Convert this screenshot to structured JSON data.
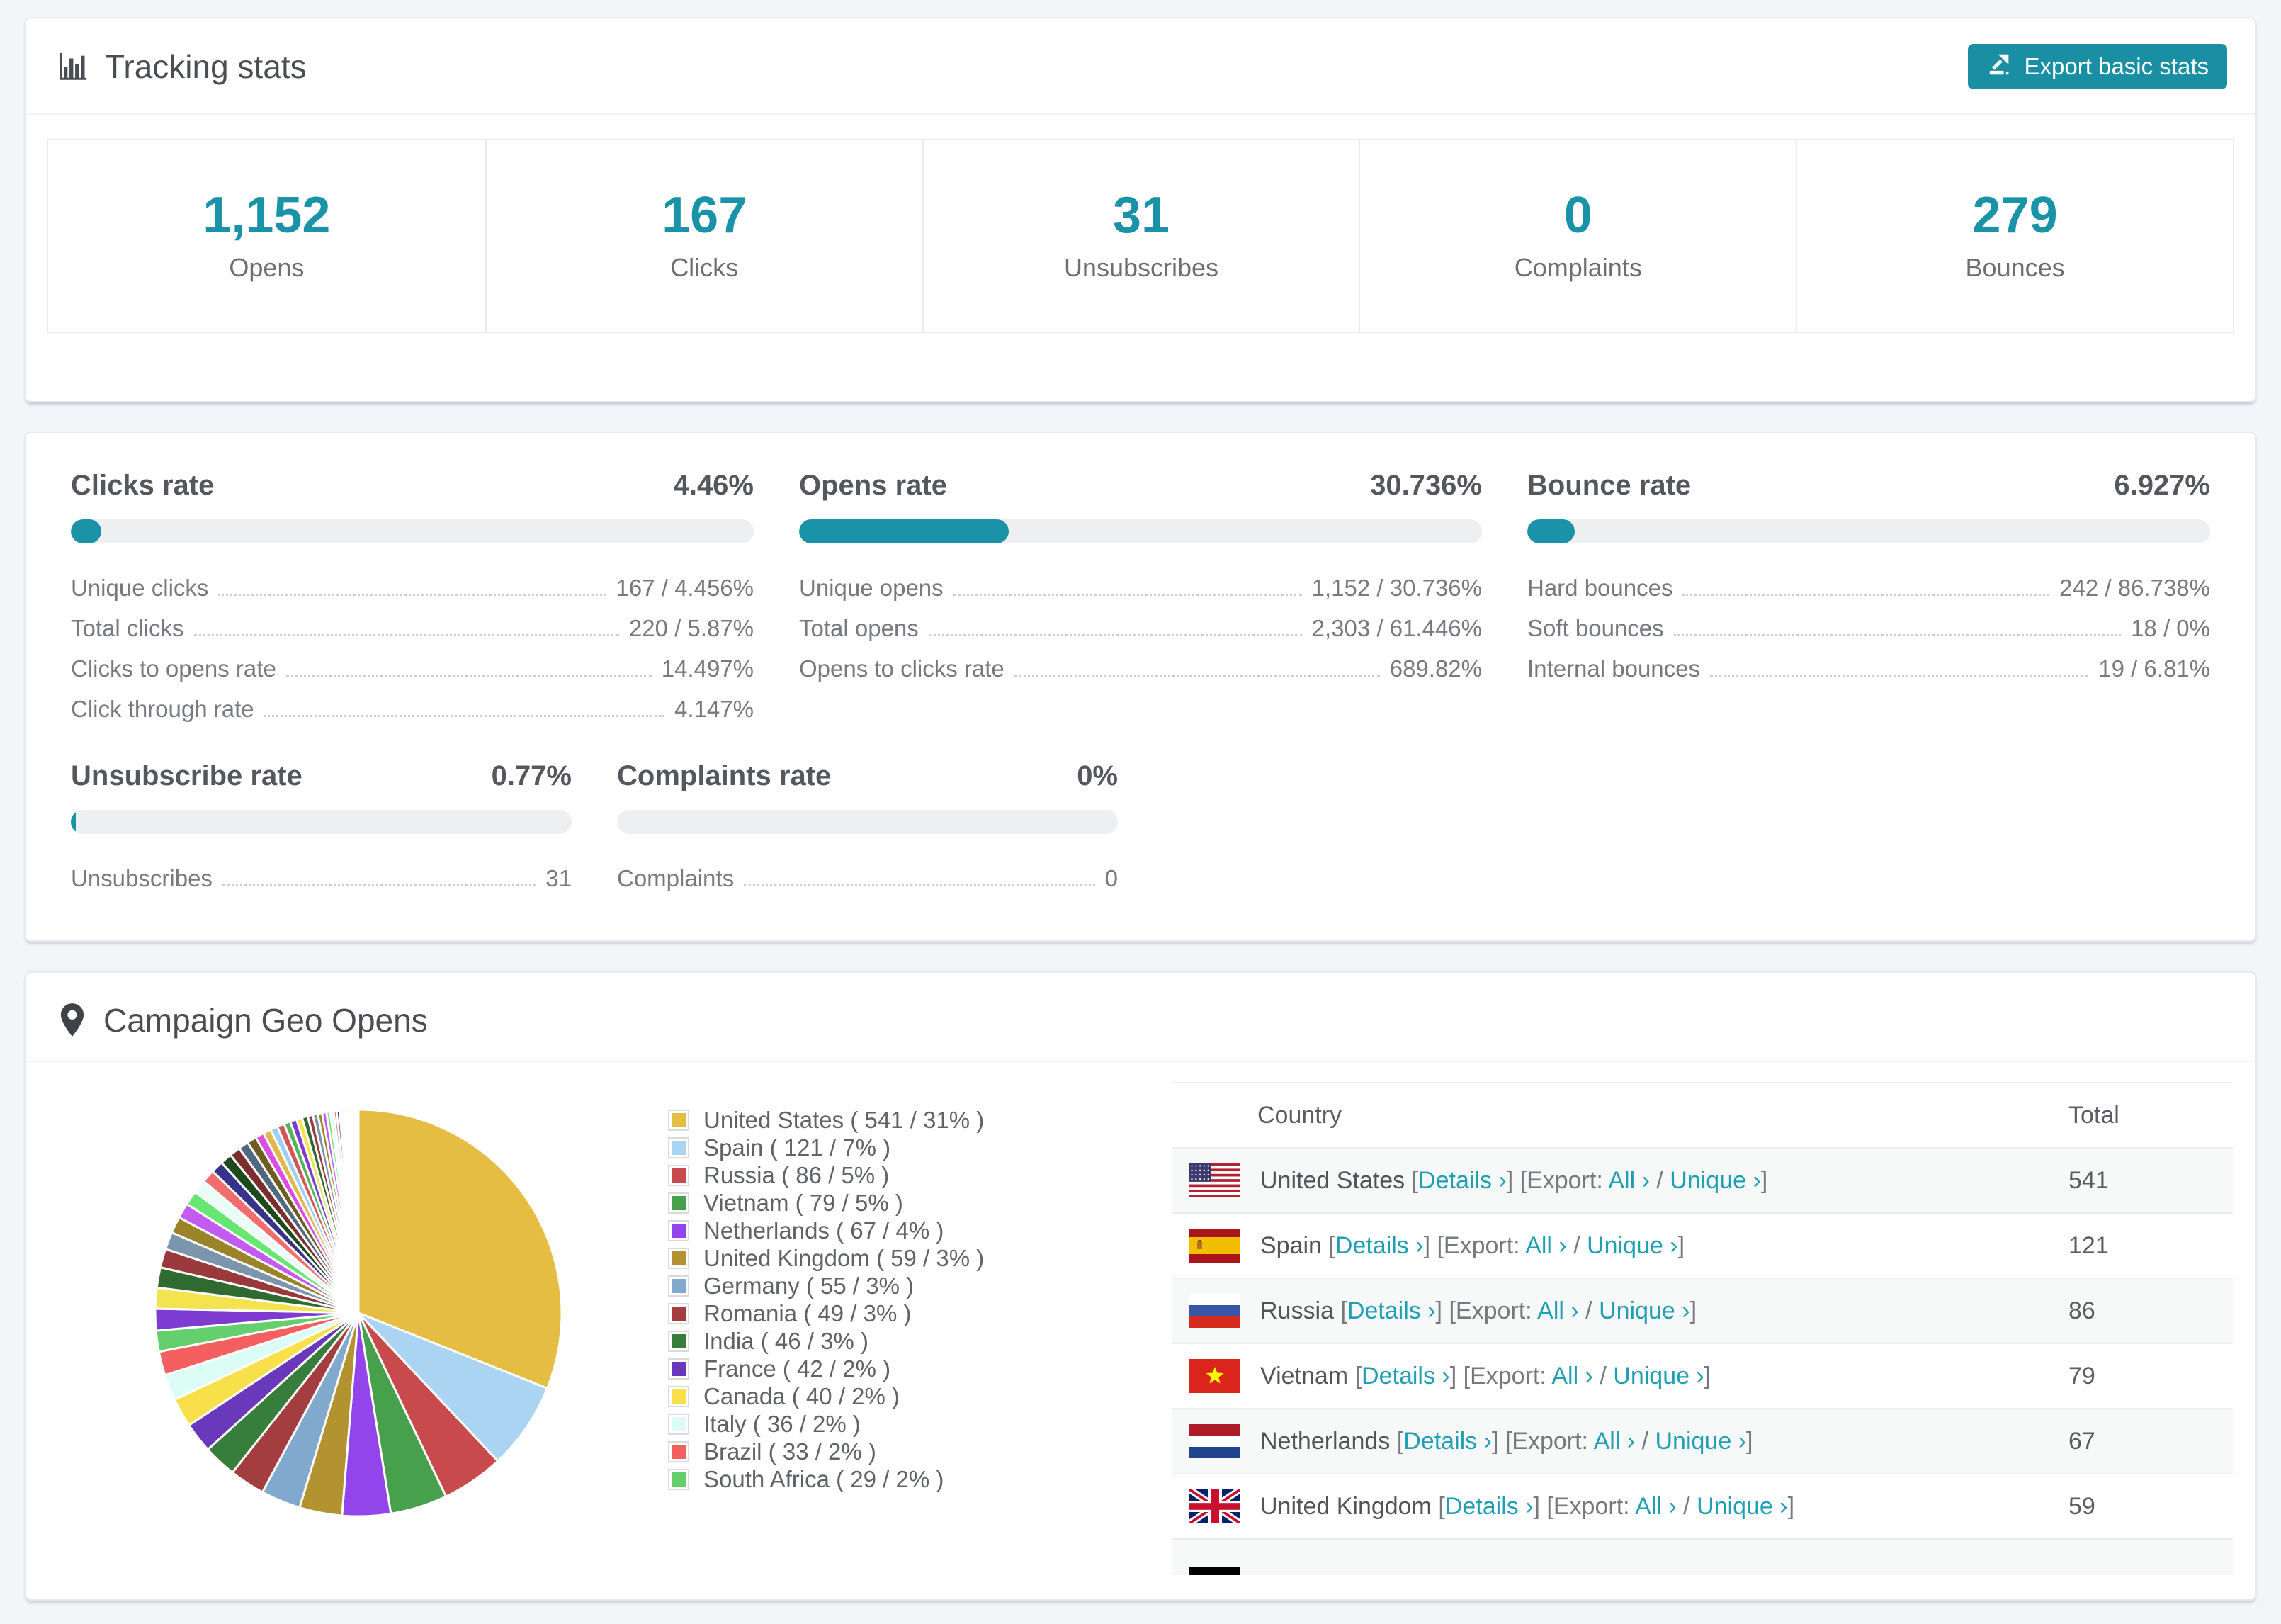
{
  "colors": {
    "accent": "#1a93a8",
    "button": "#1a8ea3",
    "link": "#209fb4",
    "bar_track": "#edeff1",
    "page_bg": "#f4f5f8"
  },
  "tracking": {
    "title": "Tracking stats",
    "icon": "bar-chart-icon",
    "export_button": {
      "label": "Export basic stats",
      "icon": "export-icon"
    },
    "stats": [
      {
        "value": "1,152",
        "label": "Opens"
      },
      {
        "value": "167",
        "label": "Clicks"
      },
      {
        "value": "31",
        "label": "Unsubscribes"
      },
      {
        "value": "0",
        "label": "Complaints"
      },
      {
        "value": "279",
        "label": "Bounces"
      }
    ]
  },
  "rates": {
    "top_row": [
      {
        "title": "Clicks rate",
        "value": "4.46%",
        "bar_percent": 4.46,
        "rows": [
          {
            "label": "Unique clicks",
            "value": "167 / 4.456%"
          },
          {
            "label": "Total clicks",
            "value": "220 / 5.87%"
          },
          {
            "label": "Clicks to opens rate",
            "value": "14.497%"
          },
          {
            "label": "Click through rate",
            "value": "4.147%"
          }
        ]
      },
      {
        "title": "Opens rate",
        "value": "30.736%",
        "bar_percent": 30.736,
        "rows": [
          {
            "label": "Unique opens",
            "value": "1,152 / 30.736%"
          },
          {
            "label": "Total opens",
            "value": "2,303 / 61.446%"
          },
          {
            "label": "Opens to clicks rate",
            "value": "689.82%"
          }
        ]
      },
      {
        "title": "Bounce rate",
        "value": "6.927%",
        "bar_percent": 6.927,
        "rows": [
          {
            "label": "Hard bounces",
            "value": "242 / 86.738%"
          },
          {
            "label": "Soft bounces",
            "value": "18 / 0%"
          },
          {
            "label": "Internal bounces",
            "value": "19 / 6.81%"
          }
        ]
      }
    ],
    "bottom_row": [
      {
        "title": "Unsubscribe rate",
        "value": "0.77%",
        "bar_percent": 0.77,
        "rows": [
          {
            "label": "Unsubscribes",
            "value": "31"
          }
        ]
      },
      {
        "title": "Complaints rate",
        "value": "0%",
        "bar_percent": 0,
        "rows": [
          {
            "label": "Complaints",
            "value": "0"
          }
        ]
      }
    ]
  },
  "geo": {
    "title": "Campaign Geo Opens",
    "icon": "location-pin-icon",
    "legend": [
      {
        "label": "United States ( 541 / 31% )",
        "color": "#e5bd43"
      },
      {
        "label": "Spain ( 121 / 7% )",
        "color": "#abd4f2"
      },
      {
        "label": "Russia ( 86 / 5% )",
        "color": "#c94a4d"
      },
      {
        "label": "Vietnam ( 79 / 5% )",
        "color": "#47a04b"
      },
      {
        "label": "Netherlands ( 67 / 4% )",
        "color": "#9145ea"
      },
      {
        "label": "United Kingdom ( 59 / 3% )",
        "color": "#b3932f"
      },
      {
        "label": "Germany ( 55 / 3% )",
        "color": "#80a9cd"
      },
      {
        "label": "Romania ( 49 / 3% )",
        "color": "#a43d3f"
      },
      {
        "label": "India ( 46 / 3% )",
        "color": "#377d3c"
      },
      {
        "label": "France ( 42 / 2% )",
        "color": "#6a39bb"
      },
      {
        "label": "Canada ( 40 / 2% )",
        "color": "#f8e04b"
      },
      {
        "label": "Italy ( 36 / 2% )",
        "color": "#dbfdf6"
      },
      {
        "label": "Brazil ( 33 / 2% )",
        "color": "#f3605f"
      },
      {
        "label": "South Africa ( 29 / 2% )",
        "color": "#65cf6d"
      }
    ],
    "table": {
      "headers": {
        "country": "Country",
        "total": "Total"
      },
      "link_text": {
        "details": "Details ›",
        "export": "Export:",
        "all": "All ›",
        "unique": "Unique ›"
      },
      "rows": [
        {
          "country": "United States",
          "flag": "us",
          "total": "541"
        },
        {
          "country": "Spain",
          "flag": "es",
          "total": "121"
        },
        {
          "country": "Russia",
          "flag": "ru",
          "total": "86"
        },
        {
          "country": "Vietnam",
          "flag": "vn",
          "total": "79"
        },
        {
          "country": "Netherlands",
          "flag": "nl",
          "total": "67"
        },
        {
          "country": "United Kingdom",
          "flag": "gb",
          "total": "59"
        },
        {
          "flag": "de",
          "partial": true
        }
      ]
    }
  },
  "chart_data": {
    "type": "pie",
    "title": "Campaign Geo Opens",
    "unit": "opens",
    "legend_position": "right",
    "start_angle_deg": 0,
    "direction": "clockwise",
    "labels": [
      "United States",
      "Spain",
      "Russia",
      "Vietnam",
      "Netherlands",
      "United Kingdom",
      "Germany",
      "Romania",
      "India",
      "France",
      "Canada",
      "Italy",
      "Brazil",
      "South Africa"
    ],
    "values": [
      541,
      121,
      86,
      79,
      67,
      59,
      55,
      49,
      46,
      42,
      40,
      36,
      33,
      29
    ],
    "percents": [
      31,
      7,
      5,
      5,
      4,
      3,
      3,
      3,
      3,
      2,
      2,
      2,
      2,
      2
    ],
    "colors": [
      "#e5bd43",
      "#abd4f2",
      "#c94a4d",
      "#47a04b",
      "#9145ea",
      "#b3932f",
      "#80a9cd",
      "#a43d3f",
      "#377d3c",
      "#6a39bb",
      "#f8e04b",
      "#dbfdf6",
      "#f3605f",
      "#65cf6d"
    ],
    "others_approx": [
      30,
      29,
      28,
      26,
      24,
      23,
      21,
      20,
      19,
      18,
      17,
      16,
      15,
      14,
      13,
      12,
      11,
      10,
      10,
      9,
      9,
      8,
      8,
      7,
      7,
      6,
      6,
      5,
      5,
      4,
      4,
      3,
      3,
      3,
      2,
      2,
      2,
      2,
      1,
      1,
      1,
      1,
      1,
      1,
      1,
      1,
      1
    ],
    "others_palette": [
      "#7d3bd1",
      "#f3e34f",
      "#2f6b31",
      "#9a393b",
      "#7b96ac",
      "#9b8428",
      "#c45bf0",
      "#66e673",
      "#eafcf6",
      "#f26d6d",
      "#37338a",
      "#1d4a1d",
      "#7c2d2d",
      "#50697f",
      "#6e5c20",
      "#d94fe3",
      "#e0b84a",
      "#9fd0f0",
      "#d15658",
      "#58b45c"
    ]
  }
}
